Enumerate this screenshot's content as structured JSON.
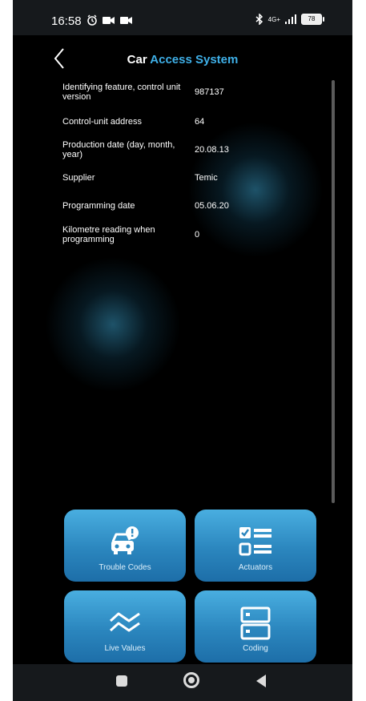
{
  "status_bar": {
    "time": "16:58",
    "network": "4G+",
    "battery": "78"
  },
  "header": {
    "title_prefix": "Car",
    "title_accent": "Access System"
  },
  "info_rows": [
    {
      "label": "Identifying feature, control unit version",
      "value": "987137"
    },
    {
      "label": "Control-unit address",
      "value": "64"
    },
    {
      "label": "Production date (day, month, year)",
      "value": "20.08.13"
    },
    {
      "label": "Supplier",
      "value": "Temic"
    },
    {
      "label": "Programming date",
      "value": "05.06.20"
    },
    {
      "label": "Kilometre reading when programming",
      "value": "0"
    }
  ],
  "tiles": {
    "trouble_codes": {
      "label": "Trouble Codes",
      "icon": "car-alert-icon"
    },
    "actuators": {
      "label": "Actuators",
      "icon": "checklist-icon"
    },
    "live_values": {
      "label": "Live Values",
      "icon": "wave-lines-icon"
    },
    "coding": {
      "label": "Coding",
      "icon": "server-icon"
    }
  },
  "colors": {
    "accent": "#3fb0e8",
    "tile": "#2b86be"
  }
}
